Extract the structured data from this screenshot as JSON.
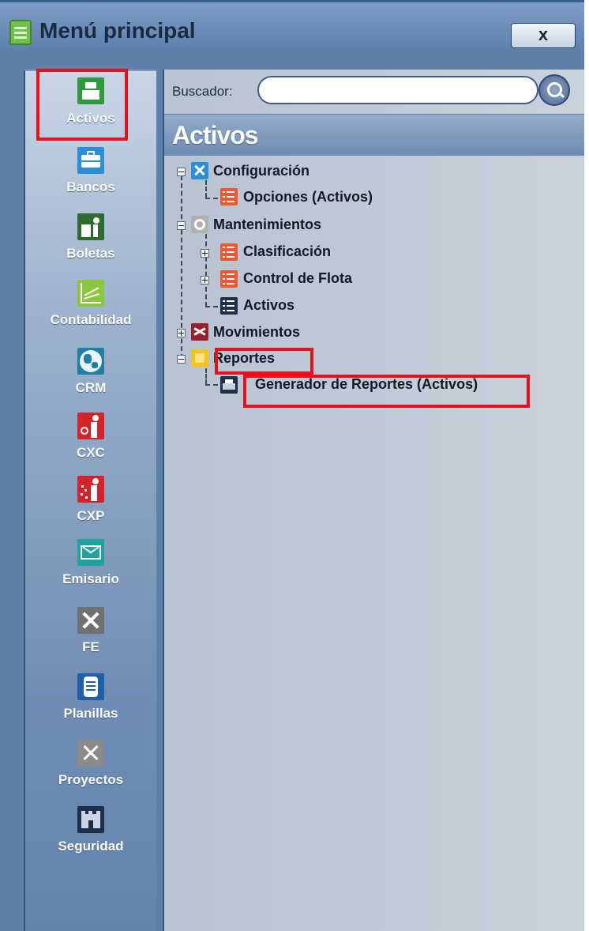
{
  "window": {
    "title": "Menú principal",
    "close_label": "x"
  },
  "sidebar": {
    "items": [
      {
        "label": "Activos",
        "icon": "cash-register-icon",
        "color": "#2f9a3a"
      },
      {
        "label": "Bancos",
        "icon": "briefcase-icon",
        "color": "#2a8fd6"
      },
      {
        "label": "Boletas",
        "icon": "person-ballot-icon",
        "color": "#2f6b2c"
      },
      {
        "label": "Contabilidad",
        "icon": "line-chart-icon",
        "color": "#8cc63f"
      },
      {
        "label": "CRM",
        "icon": "globe-icon",
        "color": "#1f7fa2"
      },
      {
        "label": "CXC",
        "icon": "person-collect-icon",
        "color": "#d6232a"
      },
      {
        "label": "CXP",
        "icon": "person-pay-icon",
        "color": "#d6232a"
      },
      {
        "label": "Emisario",
        "icon": "envelope-icon",
        "color": "#1ea3a0"
      },
      {
        "label": "FE",
        "icon": "tools-icon",
        "color": "#707070"
      },
      {
        "label": "Planillas",
        "icon": "document-icon",
        "color": "#1e5fa8"
      },
      {
        "label": "Proyectos",
        "icon": "drafting-icon",
        "color": "#8a8a8a"
      },
      {
        "label": "Seguridad",
        "icon": "castle-icon",
        "color": "#1d2f4a"
      }
    ]
  },
  "search": {
    "label": "Buscador:",
    "value": "",
    "placeholder": ""
  },
  "section": {
    "title": "Activos"
  },
  "tree": {
    "configuracion": {
      "label": "Configuración",
      "icon": "tools-icon"
    },
    "opciones": {
      "label": "Opciones (Activos)",
      "icon": "list-icon"
    },
    "mantenimientos": {
      "label": "Mantenimientos",
      "icon": "gear-icon"
    },
    "clasificacion": {
      "label": "Clasificación",
      "icon": "list-icon"
    },
    "control_flota": {
      "label": "Control de Flota",
      "icon": "list-icon"
    },
    "activos": {
      "label": "Activos",
      "icon": "list-icon"
    },
    "movimientos": {
      "label": "Movimientos",
      "icon": "shuffle-icon"
    },
    "reportes": {
      "label": "Reportes",
      "icon": "folder-icon"
    },
    "generador": {
      "label": "Generador de Reportes (Activos)",
      "icon": "printer-icon"
    }
  },
  "colors": {
    "highlight": "#e8101a",
    "window_blue": "#5f80a8"
  }
}
